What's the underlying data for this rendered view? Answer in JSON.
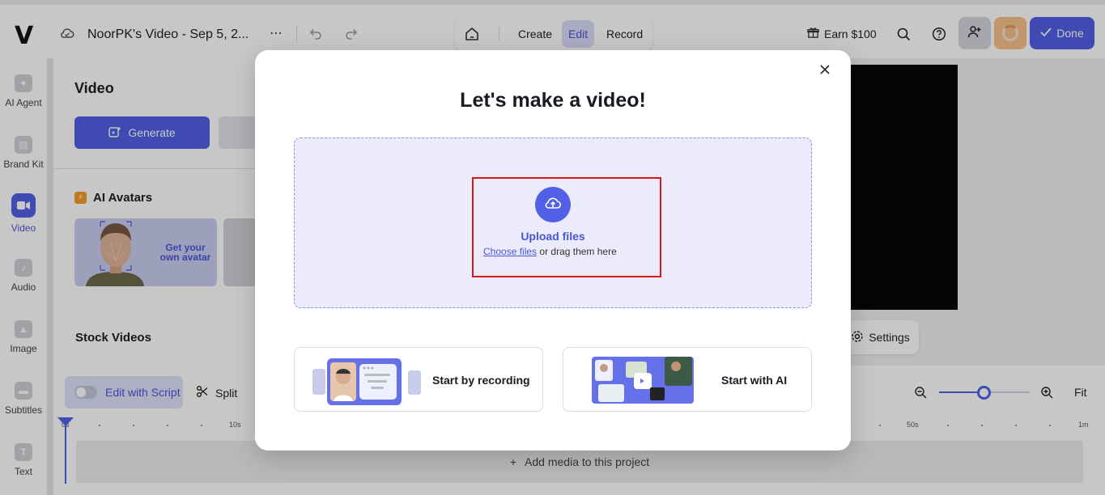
{
  "app": {
    "logo": "V",
    "project_title": "NoorPK's Video - Sep 5, 2...",
    "more": "⋯"
  },
  "modes": [
    "Create",
    "Edit",
    "Record"
  ],
  "active_mode": "Edit",
  "header_actions": {
    "earn": "Earn $100",
    "done": "Done"
  },
  "sidebar": {
    "items": [
      {
        "label": "AI Agent",
        "icon": "sparkle-icon"
      },
      {
        "label": "Brand Kit",
        "icon": "brand-kit-icon"
      },
      {
        "label": "Video",
        "icon": "video-icon"
      },
      {
        "label": "Audio",
        "icon": "music-note-icon"
      },
      {
        "label": "Image",
        "icon": "image-icon"
      },
      {
        "label": "Subtitles",
        "icon": "subtitles-icon"
      },
      {
        "label": "Text",
        "icon": "text-icon"
      }
    ],
    "active": "Video"
  },
  "panel": {
    "title": "Video",
    "generate_label": "Generate",
    "avatars_heading": "AI Avatars",
    "avatar_card_text": "Get your own avatar",
    "stock_heading": "Stock Videos"
  },
  "canvas": {
    "settings_label": "Settings"
  },
  "timeline": {
    "edit_script_label": "Edit with Script",
    "split_label": "Split",
    "fit_label": "Fit",
    "ruler_labels": [
      "0s",
      "10s",
      "50s",
      "1m"
    ],
    "add_media_label": "Add media to this project",
    "zoom_level": 0.5
  },
  "modal": {
    "title": "Let's make a video!",
    "upload_title": "Upload files",
    "choose_files": "Choose files",
    "drag_text": "or drag them here",
    "option_recording": "Start by recording",
    "option_ai": "Start with AI"
  },
  "colors": {
    "accent": "#5160e6",
    "highlight": "#d9141b",
    "dropzone_bg": "#ebebfb"
  }
}
